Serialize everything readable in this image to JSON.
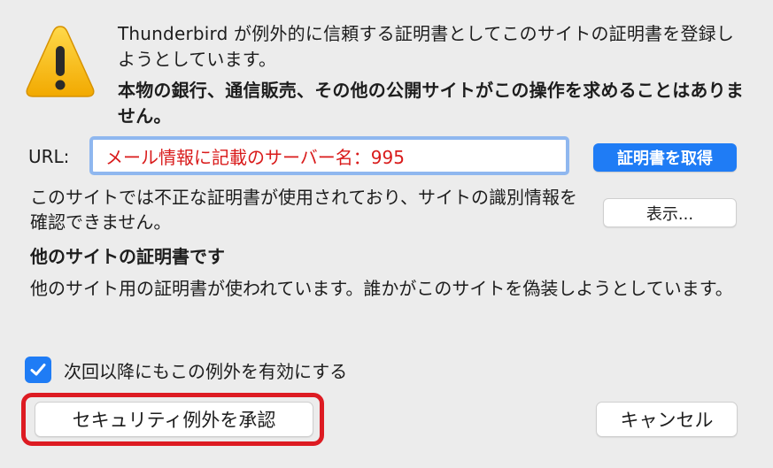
{
  "dialog": {
    "icon": "warning-icon",
    "intro_text": "Thunderbird が例外的に信頼する証明書としてこのサイトの証明書を登録しようとしています。",
    "intro_bold": "本物の銀行、通信販売、その他の公開サイトがこの操作を求めることはありません。",
    "url_label": "URL:",
    "url_value": "メール情報に記載のサーバー名：995",
    "get_cert_label": "証明書を取得",
    "status_text": "このサイトでは不正な証明書が使用されており、サイトの識別情報を確認できません。",
    "view_label": "表示...",
    "issue_heading": "他のサイトの証明書です",
    "issue_detail": "他のサイト用の証明書が使われています。誰かがこのサイトを偽装しようとしています。",
    "checkbox_label": "次回以降にもこの例外を有効にする",
    "checkbox_checked": true,
    "accept_label": "セキュリティ例外を承認",
    "cancel_label": "キャンセル"
  },
  "colors": {
    "accent": "#1f7cf5",
    "highlight": "#dd1b22",
    "url_text": "#d91b1b"
  }
}
